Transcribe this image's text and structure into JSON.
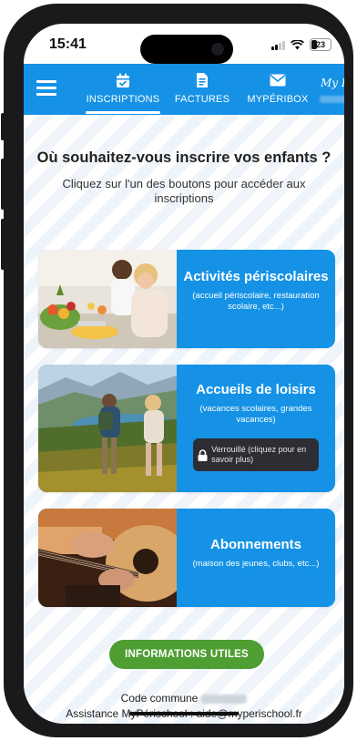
{
  "status": {
    "time": "15:41",
    "battery": "23"
  },
  "nav": {
    "tabs": [
      {
        "label": "INSCRIPTIONS",
        "icon": "calendar-check-icon",
        "active": true
      },
      {
        "label": "FACTURES",
        "icon": "invoice-icon",
        "active": false
      },
      {
        "label": "MYPÉRIBOX",
        "icon": "mail-icon",
        "active": false
      }
    ],
    "brand": "My P"
  },
  "main": {
    "heading": "Où souhaitez-vous inscrire vos enfants ?",
    "subheading": "Cliquez sur l'un des boutons pour accéder aux inscriptions",
    "cards": [
      {
        "title": "Activités périscolaires",
        "description": "(accueil périscolaire, restauration scolaire, etc...)"
      },
      {
        "title": "Accueils de loisirs",
        "description": "(vacances scolaires, grandes vacances)",
        "lock_label": "Verrouillé (cliquez pour en savoir plus)"
      },
      {
        "title": "Abonnements",
        "description": "(maison des jeunes, clubs, etc...)"
      }
    ],
    "info_button": "INFORMATIONS UTILES"
  },
  "footer": {
    "code_label": "Code commune",
    "assistance": "Assistance MyPérischool : aide@myperischool.fr"
  },
  "colors": {
    "primary": "#1592e6",
    "info_button": "#4e9e32",
    "lock_bg": "#2d2d33"
  }
}
